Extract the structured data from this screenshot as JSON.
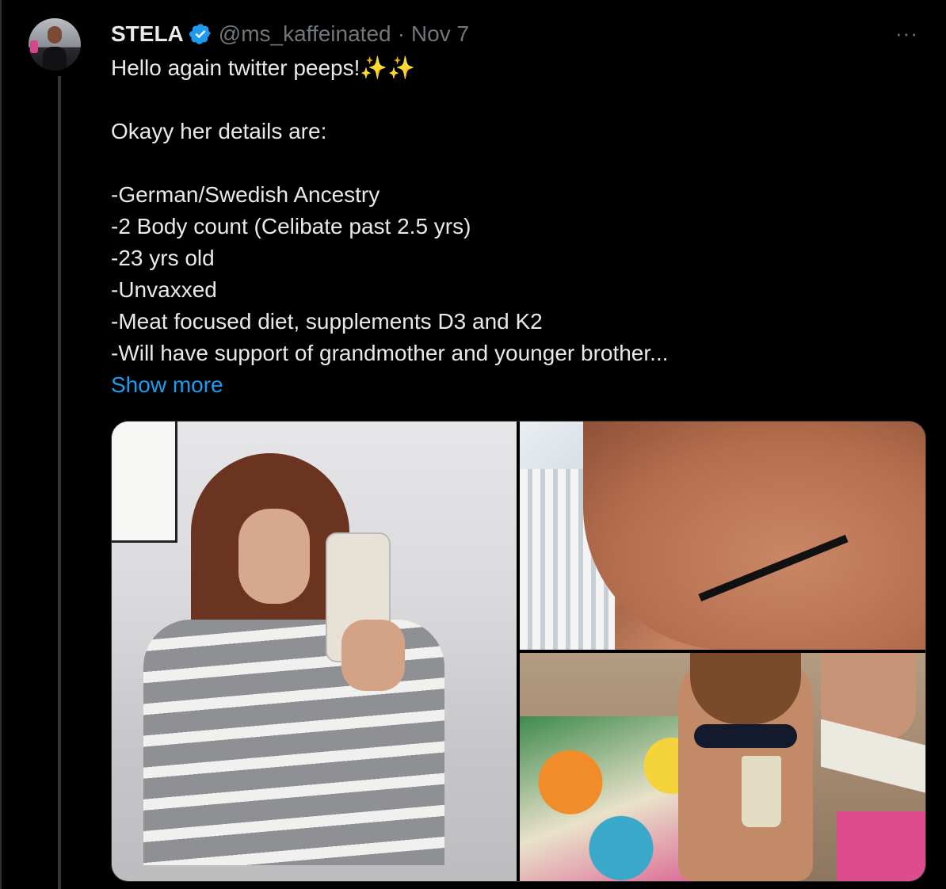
{
  "tweet": {
    "author": {
      "display_name": "STELA",
      "handle": "@ms_kaffeinated",
      "verified": true,
      "avatar_icon": "profile-photo"
    },
    "separator": "·",
    "date": "Nov 7",
    "more_icon": "ellipsis-icon",
    "more_glyph": "···",
    "text_lines": [
      "Hello again twitter peeps!✨✨",
      "",
      "Okayy her details are:",
      "",
      "-German/Swedish Ancestry",
      "-2 Body count (Celibate past 2.5 yrs)",
      "-23 yrs old",
      "-Unvaxxed",
      "-Meat focused diet, supplements D3 and K2",
      "-Will have support of grandmother and younger brother..."
    ],
    "show_more": "Show more",
    "media": {
      "count": 3
    }
  },
  "colors": {
    "background": "#000000",
    "text": "#e7e9ea",
    "muted": "#71767b",
    "link": "#1d9bf0",
    "verified": "#1d9bf0",
    "border": "#2f3336"
  }
}
